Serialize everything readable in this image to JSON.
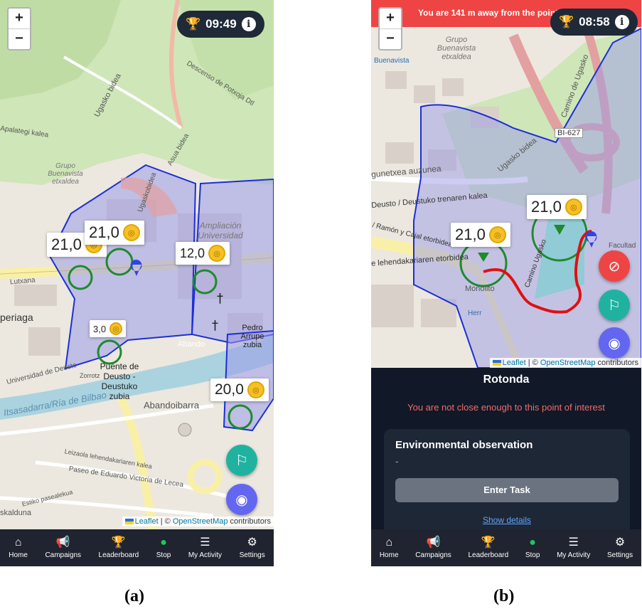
{
  "screens": {
    "a": {
      "timer": "09:49",
      "pois": [
        {
          "value": "21,0"
        },
        {
          "value": "21,0"
        },
        {
          "value": "12,0"
        },
        {
          "value": "3,0"
        },
        {
          "value": "20,0"
        }
      ],
      "map_labels": {
        "ugasko_bidea": "Ugasko bidea",
        "descenso": "Descenso de Potxoja Dtl",
        "asua_bidea": "Asua bidea",
        "palategi": "Apalategi kalea",
        "buenavista": "Grupo Buenavista etxaldea",
        "ugaskobidea2": "Ugaskobidea",
        "ampliacion": "Ampliación Universidad",
        "lutxana": "Lutxana",
        "periaga": "periaga",
        "abando": "Abando",
        "pedro": "Pedro Arrupe zubia",
        "puente": "Puente de Deusto - Deustuko zubia",
        "universidad_deusto": "Universidad de Deusto",
        "ria": "Itsasadarra/Ría de Bilbao",
        "abandoibarra": "Abandoibarra",
        "leizaola": "Leizaola lehendakariaren kalea",
        "paseo": "Paseo de Eduardo Victoria de Lecea",
        "estiko": "Estiko pasealekua",
        "skalduna": "skalduna",
        "zorrotz": "Zorrotz"
      },
      "fab_icons": [
        "route-icon",
        "location-icon"
      ]
    },
    "b": {
      "timer": "08:58",
      "alert": "You are 141 m away from the point",
      "pois": [
        {
          "value": "21,0"
        },
        {
          "value": "21,0"
        }
      ],
      "map_labels": {
        "grupo": "Grupo Buenavista etxaldea",
        "buenavista": "Buenavista",
        "camino_ugasko": "Camino de Ugasko",
        "bi627": "BI-627",
        "ugasko_bidea": "Ugasko bidea",
        "gunetxea": "gunetxea auzunea",
        "deusto_trenaren": "Deusto / Deustuko trenaren kalea",
        "ramon": "/ Ramón y Cajal etorbidea",
        "lehendakari": "e lehendakariaren etorbidea",
        "camino_ugasko2": "Camino Ugasko",
        "monolito": "Monolito",
        "facultad": "Facultad de",
        "herriko": "Herr"
      },
      "fab_icons": [
        "no-route-icon",
        "route-icon",
        "location-icon"
      ],
      "panel": {
        "title": "Rotonda",
        "warning": "You are not close enough to this point of interest",
        "card_title": "Environmental observation",
        "card_text": "-",
        "button": "Enter Task",
        "link": "Show details"
      }
    }
  },
  "attribution": {
    "leaflet": "Leaflet",
    "sep": " | © ",
    "osm": "OpenStreetMap",
    "contrib": " contributors"
  },
  "nav": [
    {
      "label": "Home",
      "icon": "home-icon"
    },
    {
      "label": "Campaigns",
      "icon": "megaphone-icon"
    },
    {
      "label": "Leaderboard",
      "icon": "trophy-icon"
    },
    {
      "label": "Stop",
      "icon": "map-pin-icon"
    },
    {
      "label": "My Activity",
      "icon": "list-icon"
    },
    {
      "label": "Settings",
      "icon": "gear-icon"
    }
  ],
  "captions": {
    "a": "(a)",
    "b": "(b)"
  },
  "zoom": {
    "in": "+",
    "out": "−"
  },
  "colors": {
    "zone_fill": "#9b9be8",
    "zone_stroke": "#1d2fd6",
    "poi_circle": "#1f8a2e",
    "walk_path": "#e01010",
    "alert_bg": "#ef4444",
    "panel_bg": "#111827",
    "fab_green": "#20b2a0",
    "fab_blue": "#6366f1",
    "fab_red": "#ef4444"
  }
}
